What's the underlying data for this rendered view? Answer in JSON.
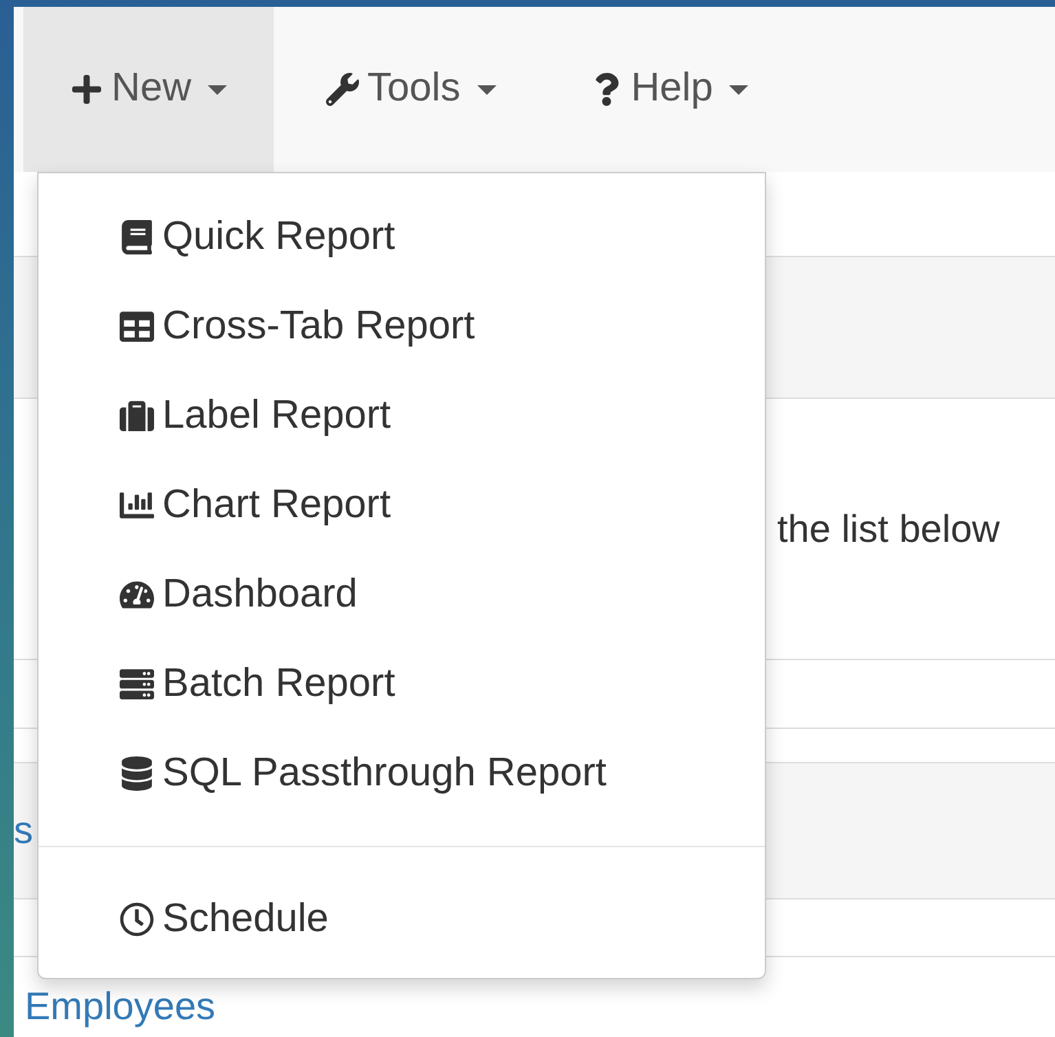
{
  "navbar": {
    "tabs": [
      {
        "label": "New",
        "selected": true
      },
      {
        "label": "Tools",
        "selected": false
      },
      {
        "label": "Help",
        "selected": false
      }
    ]
  },
  "menu": {
    "sections": [
      [
        {
          "label": "Quick Report"
        },
        {
          "label": "Cross-Tab Report"
        },
        {
          "label": "Label Report"
        },
        {
          "label": "Chart Report"
        },
        {
          "label": "Dashboard"
        },
        {
          "label": "Batch Report"
        },
        {
          "label": "SQL Passthrough Report"
        }
      ],
      [
        {
          "label": "Schedule"
        }
      ]
    ]
  },
  "content": {
    "intro_text": "the list below",
    "link_fragment": "s",
    "employees_link": "Employees"
  }
}
